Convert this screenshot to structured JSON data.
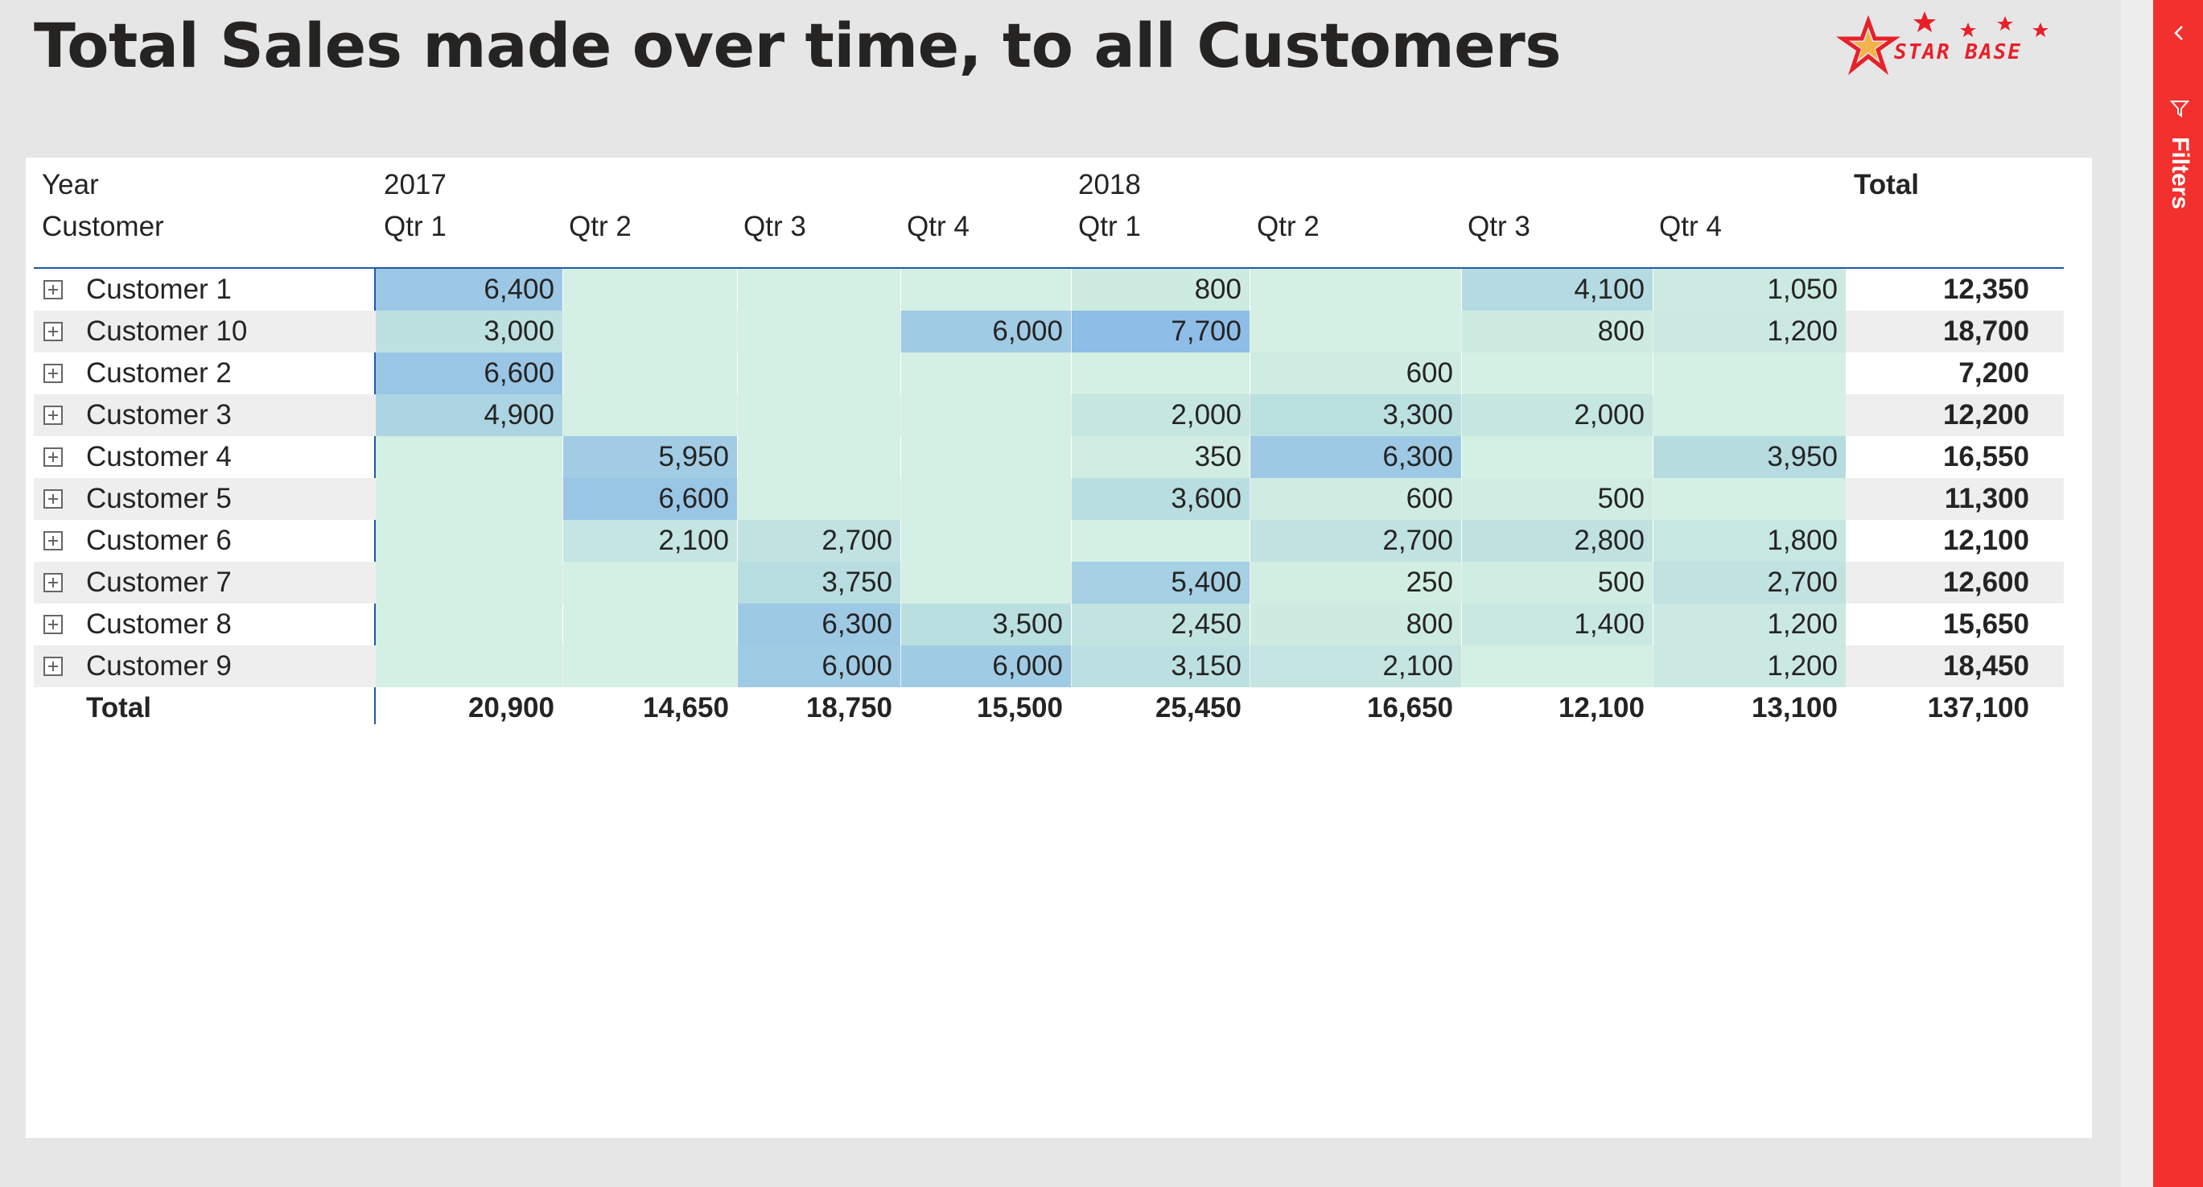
{
  "title": "Total Sales made over time, to all Customers",
  "logo": {
    "text": "STAR BASE"
  },
  "filters_pane": {
    "label": "Filters"
  },
  "colors": {
    "heat_low": "#d4efe3",
    "heat_mid": "#b7dde0",
    "heat_high": "#8ebde8",
    "accent": "#f2302e"
  },
  "matrix": {
    "header": {
      "row1_label": "Year",
      "row2_label": "Customer",
      "year_2017": "2017",
      "year_2018": "2018",
      "total": "Total",
      "quarters": [
        "Qtr 1",
        "Qtr 2",
        "Qtr 3",
        "Qtr 4",
        "Qtr 1",
        "Qtr 2",
        "Qtr 3",
        "Qtr 4"
      ]
    },
    "rows": [
      {
        "label": "Customer 1",
        "values": [
          "6,400",
          "",
          "",
          "",
          "800",
          "",
          "4,100",
          "1,050"
        ],
        "total": "12,350"
      },
      {
        "label": "Customer 10",
        "values": [
          "3,000",
          "",
          "",
          "6,000",
          "7,700",
          "",
          "800",
          "1,200"
        ],
        "total": "18,700"
      },
      {
        "label": "Customer 2",
        "values": [
          "6,600",
          "",
          "",
          "",
          "",
          "600",
          "",
          ""
        ],
        "total": "7,200"
      },
      {
        "label": "Customer 3",
        "values": [
          "4,900",
          "",
          "",
          "",
          "2,000",
          "3,300",
          "2,000",
          ""
        ],
        "total": "12,200"
      },
      {
        "label": "Customer 4",
        "values": [
          "",
          "5,950",
          "",
          "",
          "350",
          "6,300",
          "",
          "3,950"
        ],
        "total": "16,550"
      },
      {
        "label": "Customer 5",
        "values": [
          "",
          "6,600",
          "",
          "",
          "3,600",
          "600",
          "500",
          ""
        ],
        "total": "11,300"
      },
      {
        "label": "Customer 6",
        "values": [
          "",
          "2,100",
          "2,700",
          "",
          "",
          "2,700",
          "2,800",
          "1,800"
        ],
        "total": "12,100"
      },
      {
        "label": "Customer 7",
        "values": [
          "",
          "",
          "3,750",
          "",
          "5,400",
          "250",
          "500",
          "2,700"
        ],
        "total": "12,600"
      },
      {
        "label": "Customer 8",
        "values": [
          "",
          "",
          "6,300",
          "3,500",
          "2,450",
          "800",
          "1,400",
          "1,200"
        ],
        "total": "15,650"
      },
      {
        "label": "Customer 9",
        "values": [
          "",
          "",
          "6,000",
          "6,000",
          "3,150",
          "2,100",
          "",
          "1,200"
        ],
        "total": "18,450"
      }
    ],
    "total_row": {
      "label": "Total",
      "values": [
        "20,900",
        "14,650",
        "18,750",
        "15,500",
        "25,450",
        "16,650",
        "12,100",
        "13,100"
      ],
      "total": "137,100"
    }
  }
}
